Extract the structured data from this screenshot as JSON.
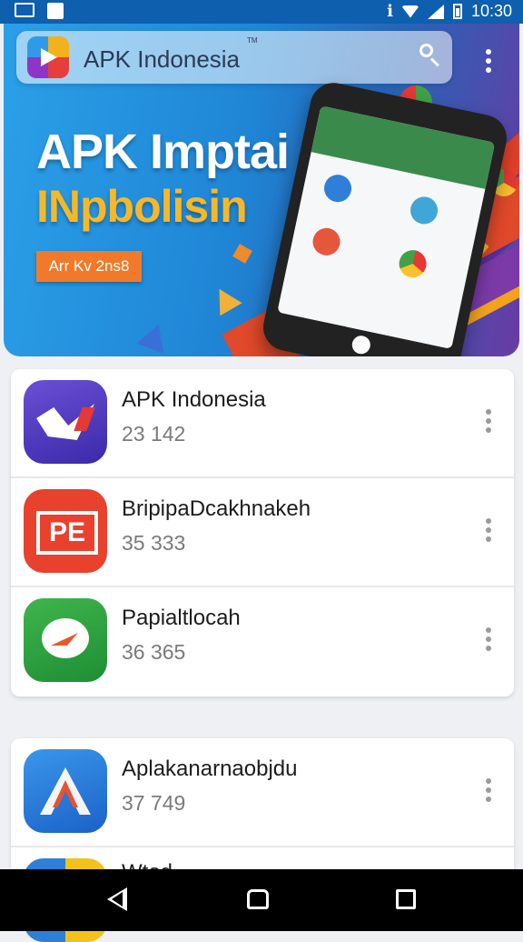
{
  "status_bar": {
    "time": "10:30"
  },
  "search": {
    "title": "APK Indonesia",
    "trademark": "TM"
  },
  "banner": {
    "headline_line1": "APK Imptai",
    "headline_line2": "INpbolisin",
    "badge": "Arr Kv 2ns8"
  },
  "apps": [
    {
      "name": "APK Indonesia",
      "meta": "23 142",
      "icon": "purple-wave-icon"
    },
    {
      "name": "BripipaDcakhnakeh",
      "meta": "35 333",
      "icon": "red-pe-icon"
    },
    {
      "name": "Papialtlocah",
      "meta": "36 365",
      "icon": "green-chat-icon"
    },
    {
      "name": "Aplakanarnaobjdu",
      "meta": "37 749",
      "icon": "blue-a-icon"
    },
    {
      "name": "Wtod",
      "icon": "yellow-blue-icon"
    }
  ],
  "colors": {
    "status_bar": "#0e5fae",
    "accent_orange": "#f07a2a",
    "headline_yellow": "#f5b82a"
  }
}
